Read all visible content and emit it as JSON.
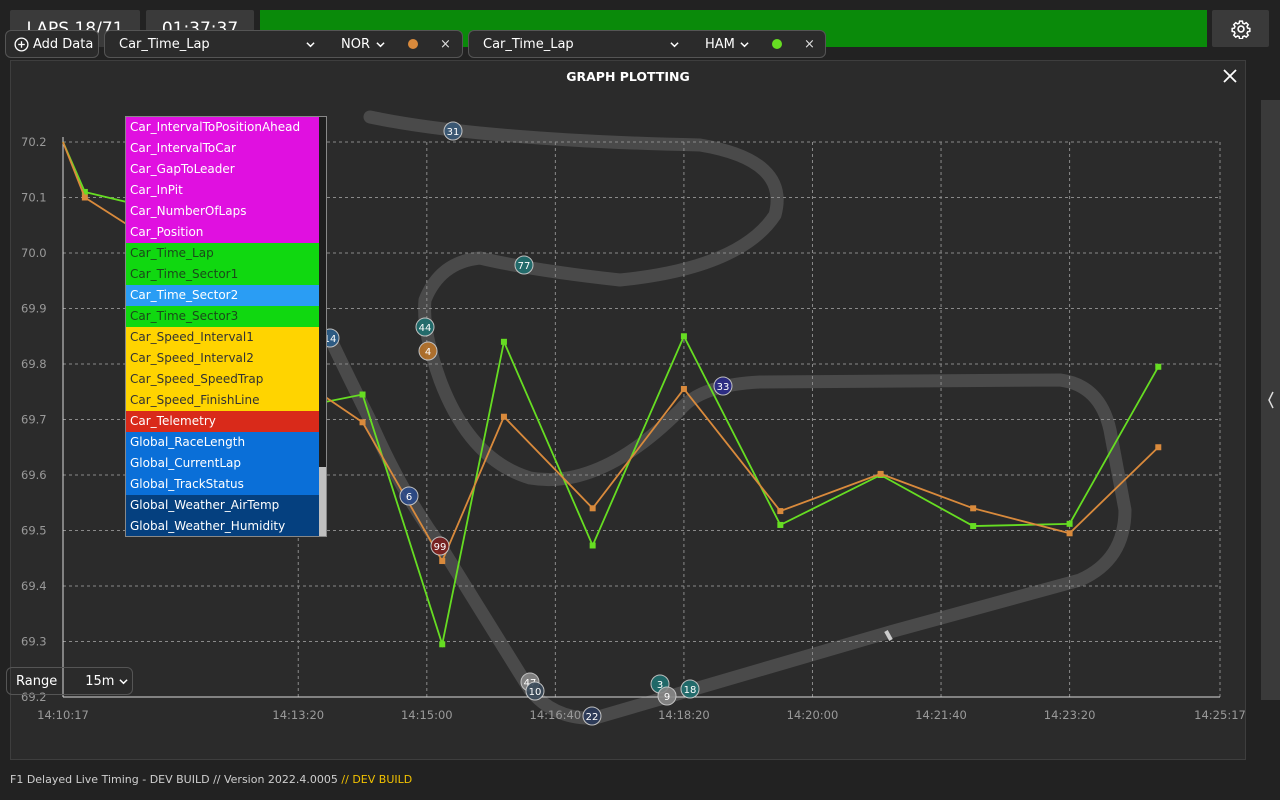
{
  "header": {
    "laps": "LAPS 18/71",
    "clock": "01:37:37",
    "status_color": "#0a8a0a",
    "settings_icon": "gear-icon"
  },
  "panel": {
    "title": "GRAPH PLOTTING",
    "close_icon": "close-icon"
  },
  "toolbar": {
    "add_data_label": "Add Data",
    "add_icon": "plus-circle-icon",
    "selectors": [
      {
        "metric": "Car_Time_Lap",
        "driver": "NOR",
        "color": "#d98a3c",
        "remove": "×"
      },
      {
        "metric": "Car_Time_Lap",
        "driver": "HAM",
        "color": "#66dd22",
        "remove": "×"
      }
    ]
  },
  "dropdown": {
    "items": [
      {
        "label": "Car_IntervalToPositionAhead",
        "bg": "#e010e0",
        "fg": "#ffffff"
      },
      {
        "label": "Car_IntervalToCar",
        "bg": "#e010e0",
        "fg": "#ffffff"
      },
      {
        "label": "Car_GapToLeader",
        "bg": "#e010e0",
        "fg": "#ffffff"
      },
      {
        "label": "Car_InPit",
        "bg": "#e010e0",
        "fg": "#ffffff"
      },
      {
        "label": "Car_NumberOfLaps",
        "bg": "#e010e0",
        "fg": "#ffffff"
      },
      {
        "label": "Car_Position",
        "bg": "#e010e0",
        "fg": "#ffffff"
      },
      {
        "label": "Car_Time_Lap",
        "bg": "#10d810",
        "fg": "#1a4a1a"
      },
      {
        "label": "Car_Time_Sector1",
        "bg": "#10d810",
        "fg": "#1a4a1a"
      },
      {
        "label": "Car_Time_Sector2",
        "bg": "#2a9df4",
        "fg": "#ffffff"
      },
      {
        "label": "Car_Time_Sector3",
        "bg": "#10d810",
        "fg": "#1a4a1a"
      },
      {
        "label": "Car_Speed_Interval1",
        "bg": "#ffd400",
        "fg": "#333333"
      },
      {
        "label": "Car_Speed_Interval2",
        "bg": "#ffd400",
        "fg": "#333333"
      },
      {
        "label": "Car_Speed_SpeedTrap",
        "bg": "#ffd400",
        "fg": "#333333"
      },
      {
        "label": "Car_Speed_FinishLine",
        "bg": "#ffd400",
        "fg": "#333333"
      },
      {
        "label": "Car_Telemetry",
        "bg": "#d92a1a",
        "fg": "#ffffff"
      },
      {
        "label": "Global_RaceLength",
        "bg": "#0a6fd8",
        "fg": "#ffffff"
      },
      {
        "label": "Global_CurrentLap",
        "bg": "#0a6fd8",
        "fg": "#ffffff"
      },
      {
        "label": "Global_TrackStatus",
        "bg": "#0a6fd8",
        "fg": "#ffffff"
      },
      {
        "label": "Global_Weather_AirTemp",
        "bg": "#05407f",
        "fg": "#ffffff"
      },
      {
        "label": "Global_Weather_Humidity",
        "bg": "#05407f",
        "fg": "#ffffff"
      }
    ]
  },
  "range": {
    "label": "Range",
    "value": "15m"
  },
  "footer": {
    "main": "F1 Delayed Live Timing - DEV BUILD // Version 2022.4.0005",
    "highlight": "// DEV BUILD"
  },
  "chart_data": {
    "type": "line",
    "ylim": [
      69.2,
      70.2
    ],
    "xlim": [
      "14:10:17",
      "14:25:17"
    ],
    "y_ticks": [
      "69.2",
      "69.3",
      "69.4",
      "69.5",
      "69.6",
      "69.7",
      "69.8",
      "69.9",
      "70.0",
      "70.1",
      "70.2"
    ],
    "x_ticks": [
      "14:10:17",
      "14:13:20",
      "14:15:00",
      "14:16:40",
      "14:18:20",
      "14:20:00",
      "14:21:40",
      "14:23:20",
      "14:25:17"
    ],
    "grid": true,
    "series": [
      {
        "name": "NOR",
        "color": "#d98a3c",
        "x": [
          "14:10:17",
          "14:10:34",
          "14:11:28",
          "14:12:22",
          "14:13:16",
          "14:14:10",
          "14:15:12",
          "14:16:00",
          "14:17:09",
          "14:18:20",
          "14:19:35",
          "14:20:53",
          "14:22:05",
          "14:23:20",
          "14:24:29"
        ],
        "values": [
          70.2,
          70.1,
          70.02,
          69.92,
          69.78,
          69.695,
          69.445,
          69.705,
          69.54,
          69.755,
          69.535,
          69.602,
          69.54,
          69.495,
          69.65
        ]
      },
      {
        "name": "HAM",
        "color": "#66dd22",
        "x": [
          "14:10:17",
          "14:10:34",
          "14:11:28",
          "14:12:22",
          "14:13:16",
          "14:14:10",
          "14:15:12",
          "14:16:00",
          "14:17:09",
          "14:18:20",
          "14:19:35",
          "14:20:53",
          "14:22:05",
          "14:23:20",
          "14:24:29"
        ],
        "values": [
          70.2,
          70.11,
          70.08,
          69.98,
          69.72,
          69.745,
          69.295,
          69.84,
          69.473,
          69.85,
          69.51,
          69.6,
          69.508,
          69.512,
          69.795
        ]
      }
    ],
    "track_markers": [
      {
        "label": "31",
        "color": "#3a5a78"
      },
      {
        "label": "77",
        "color": "#1f6f6f"
      },
      {
        "label": "44",
        "color": "#1f6f6f"
      },
      {
        "label": "4",
        "color": "#b8742a"
      },
      {
        "label": "14",
        "color": "#2a5d8a"
      },
      {
        "label": "33",
        "color": "#2a2a8a"
      },
      {
        "label": "6",
        "color": "#2a4a8a"
      },
      {
        "label": "99",
        "color": "#7a1e1e"
      },
      {
        "label": "47",
        "color": "#888888"
      },
      {
        "label": "10",
        "color": "#3a4a5a"
      },
      {
        "label": "22",
        "color": "#2a3a5a"
      },
      {
        "label": "3",
        "color": "#1f6f6f"
      },
      {
        "label": "9",
        "color": "#888888"
      },
      {
        "label": "18",
        "color": "#1f6f6f"
      }
    ]
  }
}
